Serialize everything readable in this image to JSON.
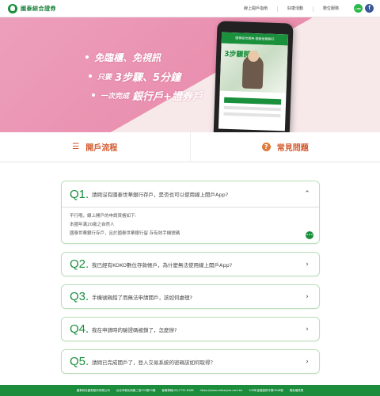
{
  "header": {
    "brand": "國泰綜合證券",
    "nav": [
      "線上開戶指南",
      "好康活動",
      "數位服務"
    ],
    "social": {
      "line": "LINE",
      "facebook": "f"
    }
  },
  "banner": {
    "slogans": [
      {
        "text": "免臨櫃、免視訊"
      },
      {
        "prefix": "只要",
        "big": "3步驟、5分鐘"
      },
      {
        "prefix": "一次完成",
        "big": "銀行戶+證券戶"
      }
    ],
    "phone": {
      "app_bar": "國泰綜合證券 國泰世華銀行",
      "steps_text": "3步驟開戶"
    }
  },
  "tabs": [
    {
      "label": "開戶流程",
      "icon": "list-icon"
    },
    {
      "label": "常見問題",
      "icon": "question-icon"
    }
  ],
  "faq": [
    {
      "no": "Q1.",
      "question": "請問沒有國泰世華銀行存戶，是否也可以使用線上開戶App?",
      "expanded": true,
      "answer": [
        "不行哦，線上開戶的申請資格如下:",
        "本國年滿20歲之自然人",
        "國泰世華銀行存戶，且於國泰世華銀行留 存有效手機號碼"
      ]
    },
    {
      "no": "Q2.",
      "question": "我已經有KOKO數位存款帳戶，為什麼無法使用線上開戶App?",
      "expanded": false
    },
    {
      "no": "Q3.",
      "question": "手機號碼錯了而無法申請開戶，該如何處理?",
      "expanded": false
    },
    {
      "no": "Q4.",
      "question": "我在申請時的驗證碼被鎖了，怎麼辦?",
      "expanded": false
    },
    {
      "no": "Q5.",
      "question": "請問已完成開戶了，登入交易系統的密碼該如何取得？",
      "expanded": false
    }
  ],
  "footer": {
    "items": [
      "國泰綜合證券股份有限公司",
      "台北市敦化南路二段333號19樓",
      "客服專線(02)7732-8168",
      "https://www.cathayses.com.tw",
      "108年金管證券字第0048號",
      "隱私權政策"
    ]
  },
  "colors": {
    "brand_green": "#1a8f3c",
    "accent_orange": "#d35a2e",
    "banner_pink": "#ea94b2"
  }
}
